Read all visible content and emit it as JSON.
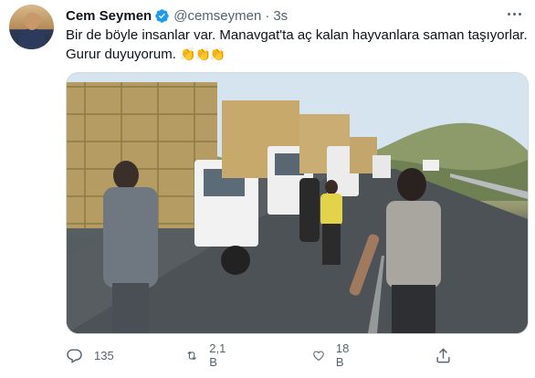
{
  "tweet": {
    "author_name": "Cem Seymen",
    "handle": "@cemseymen",
    "separator": "·",
    "time": "3s",
    "text_line1": "Bir de böyle insanlar var. Manavgat'ta aç kalan hayvanlara saman taşıyorlar.",
    "text_line2": "Gurur duyuyorum.",
    "emoji": "👏👏👏",
    "verified": true,
    "media_description": "Line of trucks loaded with hay bales on a highway with people walking"
  },
  "actions": {
    "reply_count": "135",
    "retweet_count": "2,1 B",
    "like_count": "18 B"
  },
  "colors": {
    "accent": "#1d9bf0",
    "secondary_text": "#536471",
    "primary_text": "#0f1419"
  }
}
